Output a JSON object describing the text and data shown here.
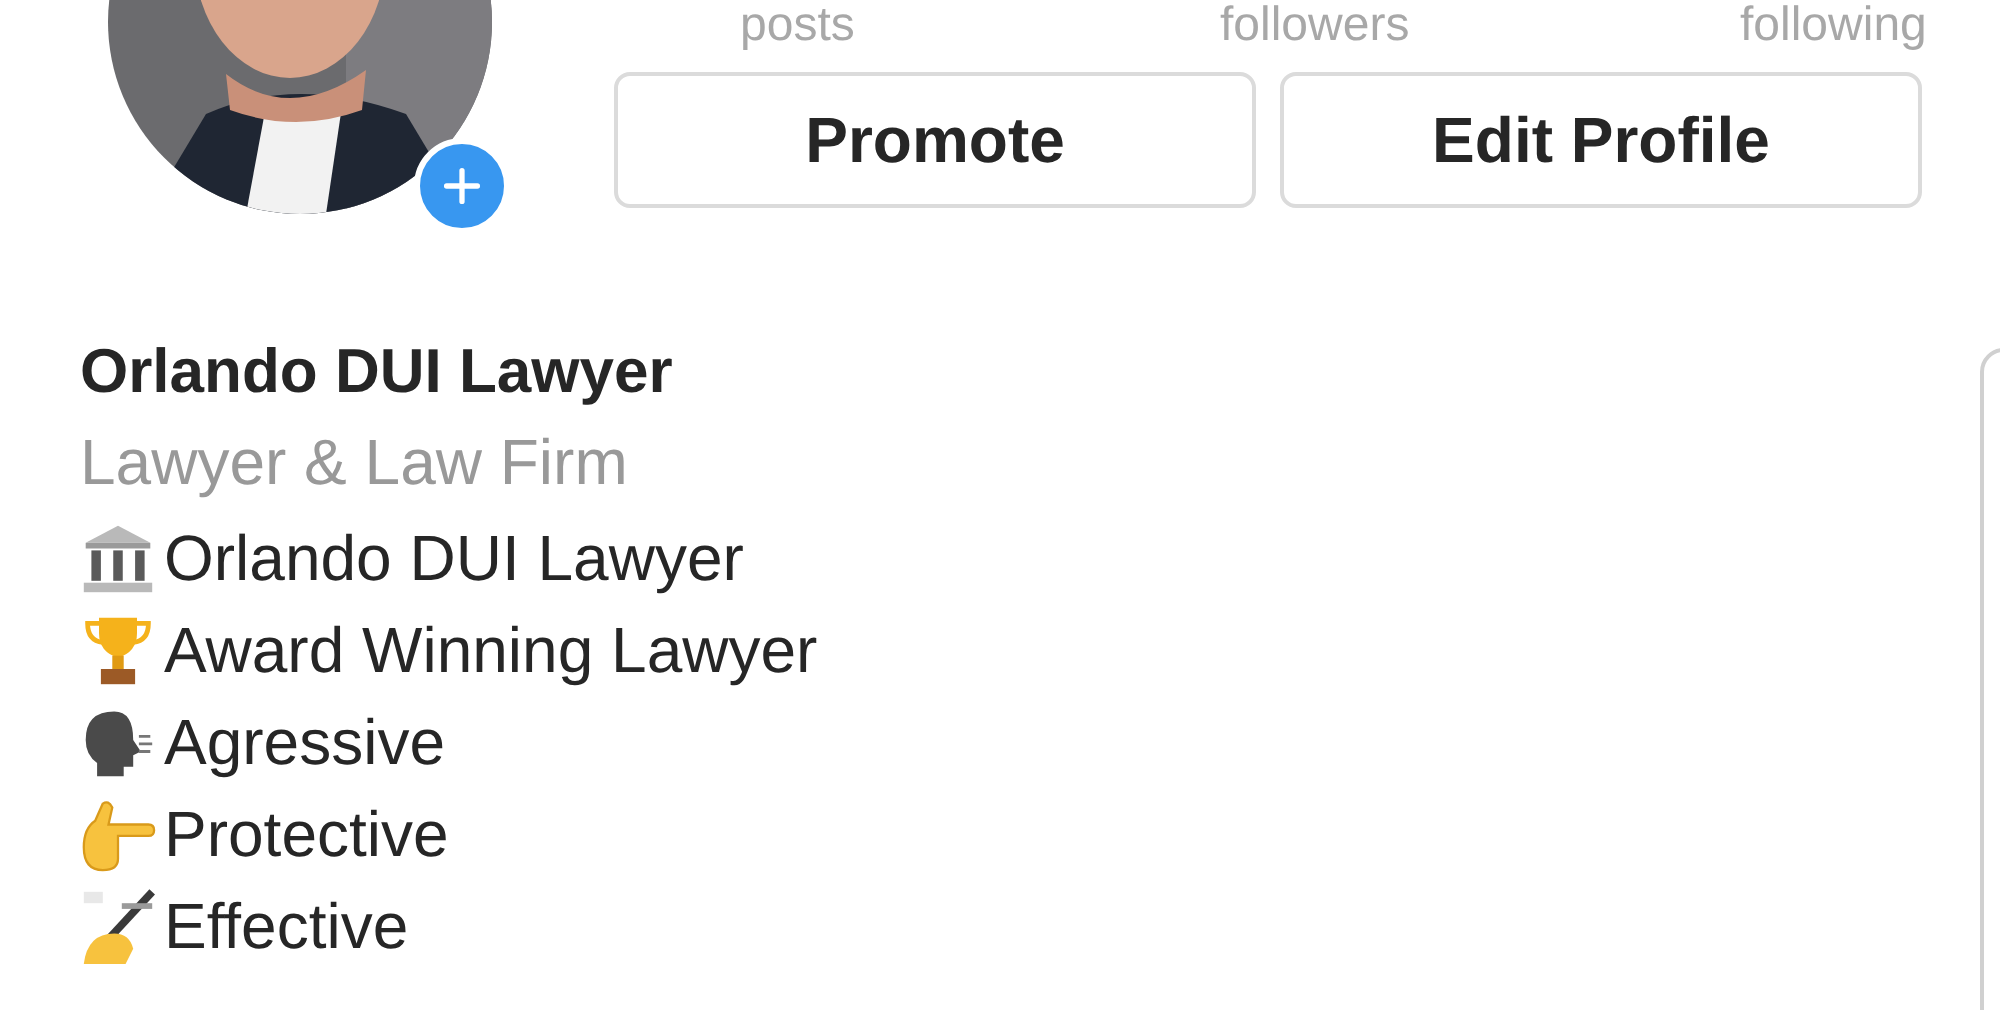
{
  "stats_labels": [
    "posts",
    "followers",
    "following"
  ],
  "buttons": [
    "Promote",
    "Edit Profile"
  ],
  "profile": {
    "name": "Orlando DUI Lawyer",
    "category": "Lawyer & Law Firm"
  },
  "bio": [
    {
      "kind": "bank",
      "text": "Orlando DUI Lawyer"
    },
    {
      "kind": "trophy",
      "text": "Award Winning Lawyer"
    },
    {
      "kind": "speaking",
      "text": "Agressive"
    },
    {
      "kind": "pointing",
      "text": "Protective"
    },
    {
      "kind": "writing",
      "text": "Effective"
    }
  ]
}
